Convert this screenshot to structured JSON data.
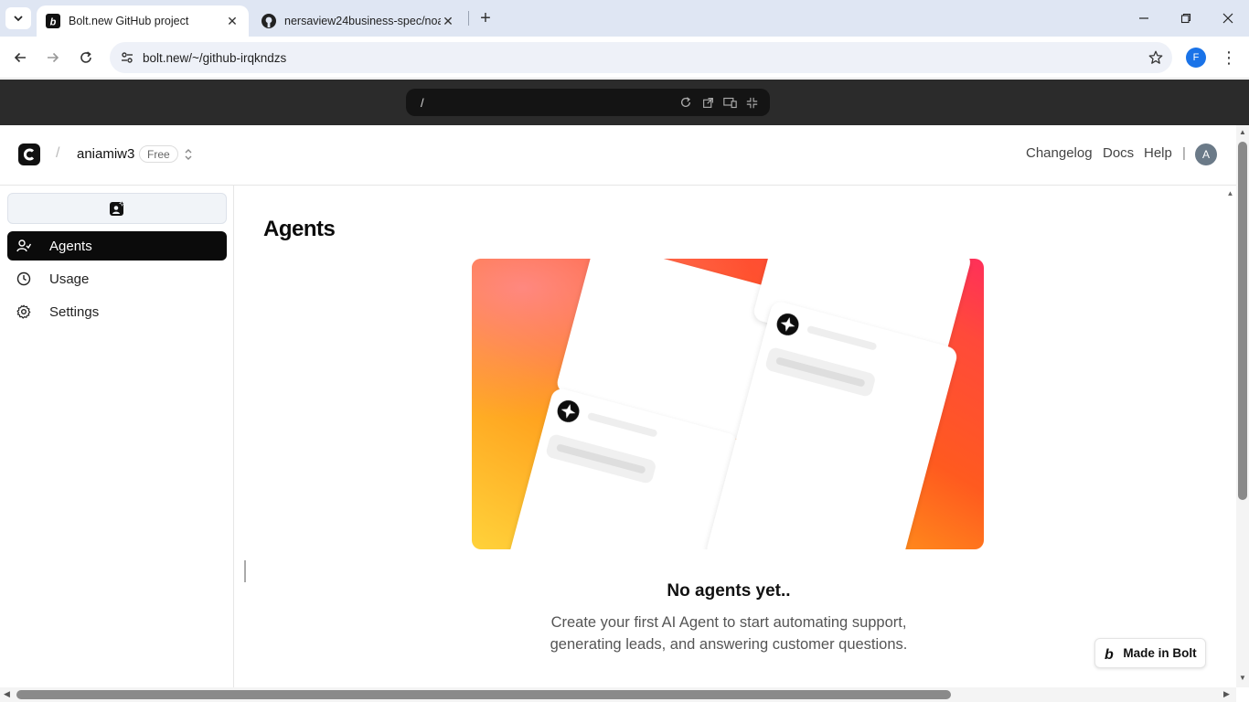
{
  "browser": {
    "tabs": [
      {
        "title": "Bolt.new GitHub project",
        "active": true
      },
      {
        "title": "nersaview24business-spec/noa",
        "active": false
      }
    ],
    "address": "bolt.new/~/github-irqkndzs",
    "profile_initial": "F"
  },
  "preview": {
    "path": "/"
  },
  "header": {
    "org_name": "aniamiw3",
    "plan_badge": "Free",
    "links": [
      "Changelog",
      "Docs",
      "Help"
    ],
    "separator": "|",
    "avatar_initial": "A"
  },
  "sidebar": {
    "items": [
      {
        "label": "Agents",
        "icon": "agents-icon",
        "active": true
      },
      {
        "label": "Usage",
        "icon": "clock-icon",
        "active": false
      },
      {
        "label": "Settings",
        "icon": "gear-icon",
        "active": false
      }
    ]
  },
  "main": {
    "title": "Agents",
    "empty_title": "No agents yet..",
    "empty_desc_line1": "Create your first AI Agent to start automating support,",
    "empty_desc_line2": "generating leads, and answering customer questions."
  },
  "badge": {
    "label": "Made in Bolt"
  },
  "colors": {
    "active_nav_bg": "#0b0b0b",
    "tabstrip_bg": "#dfe6f3",
    "preview_bar_bg": "#2b2b2b",
    "profile_blue": "#1a73e8"
  }
}
